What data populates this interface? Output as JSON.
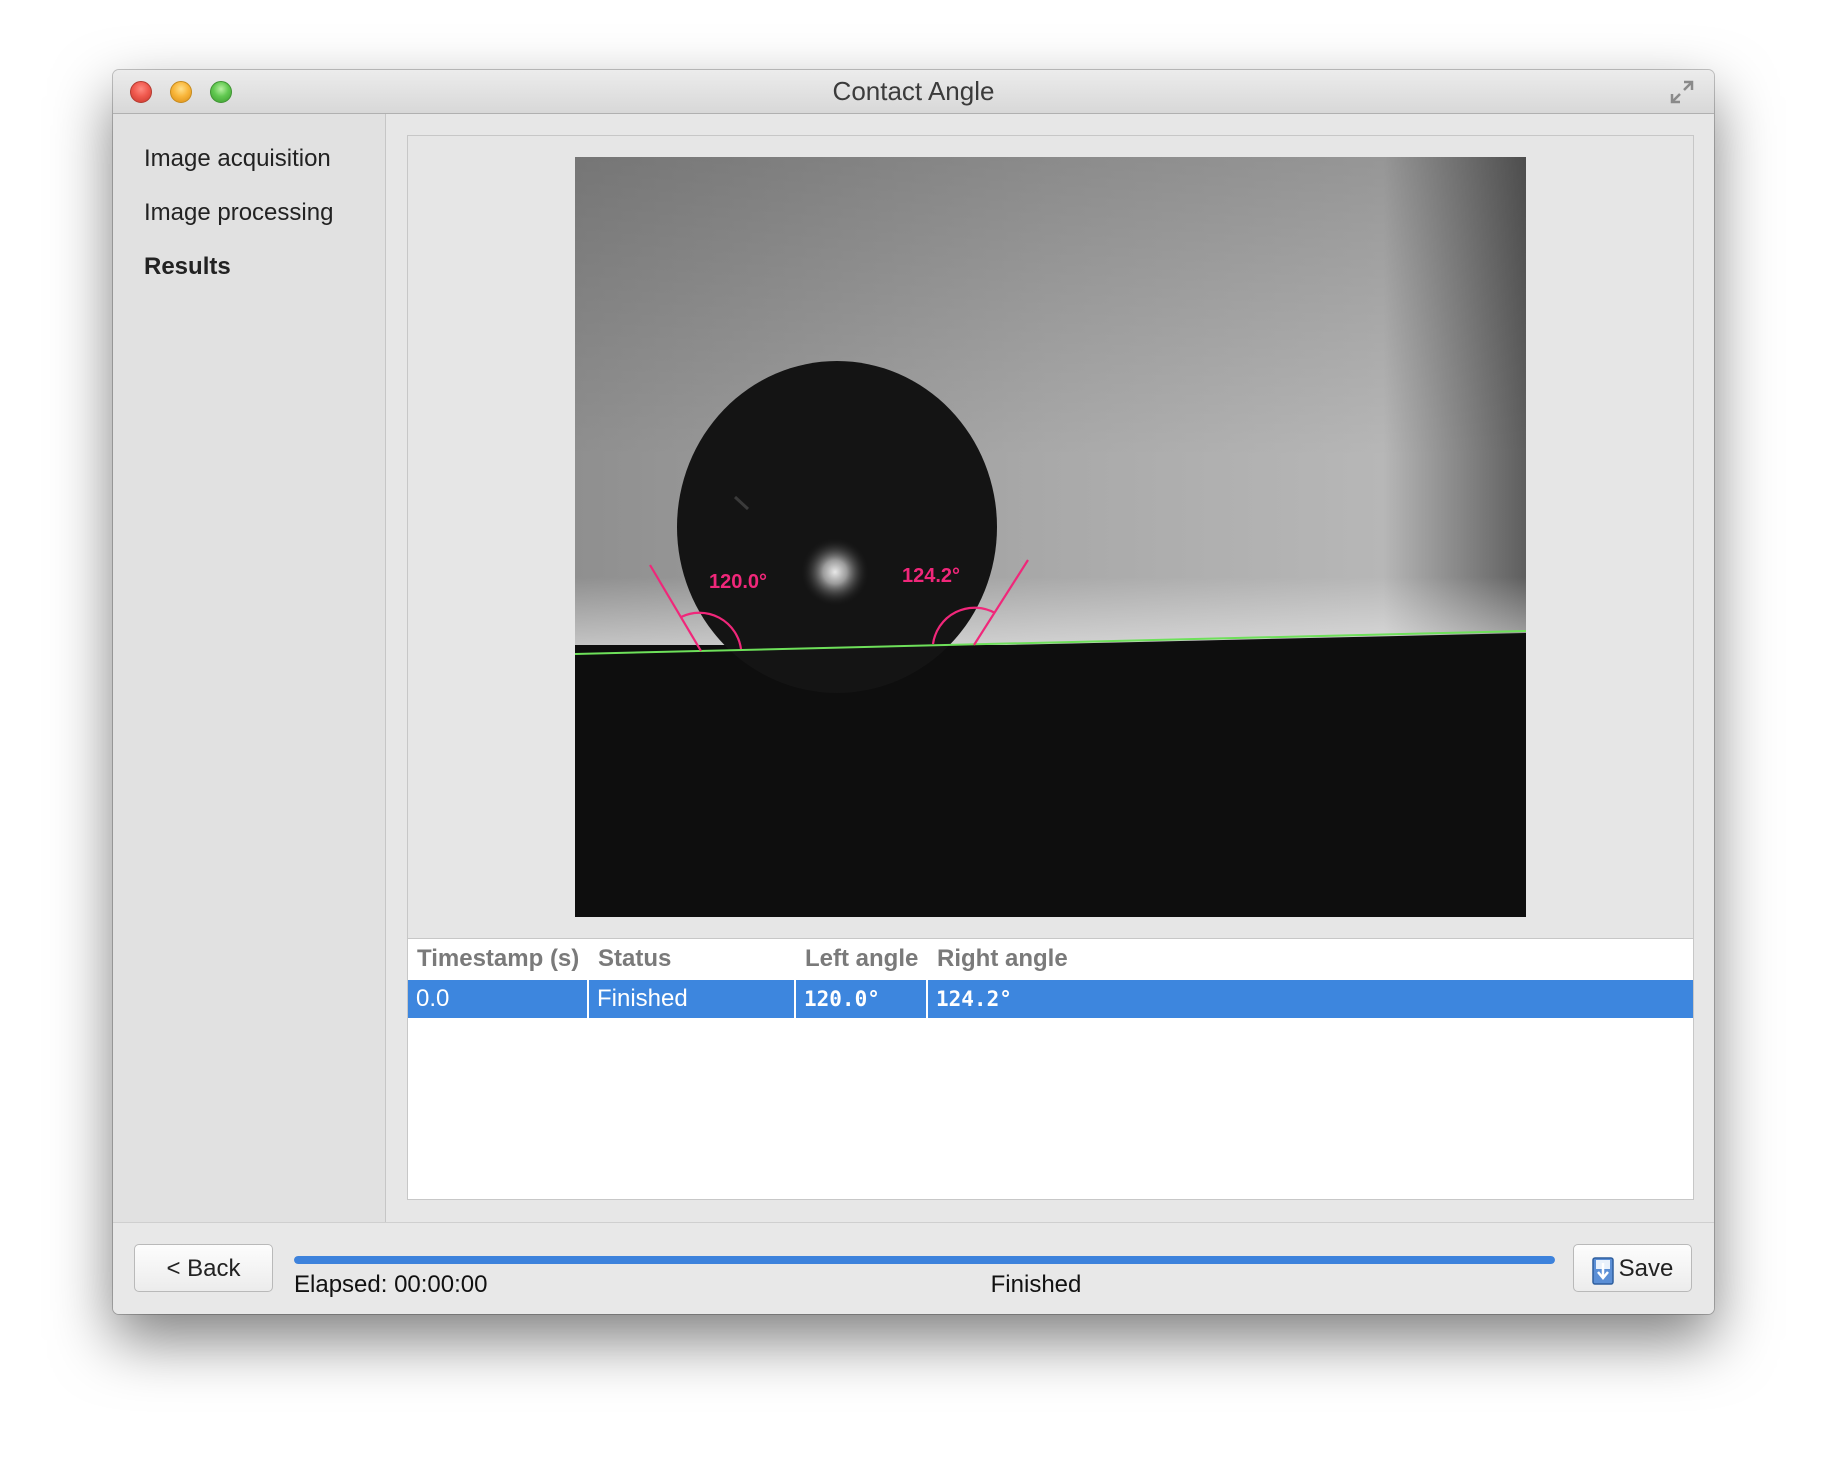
{
  "window": {
    "title": "Contact Angle"
  },
  "sidebar": {
    "items": [
      {
        "label": "Image acquisition",
        "active": false
      },
      {
        "label": "Image processing",
        "active": false
      },
      {
        "label": "Results",
        "active": true
      }
    ]
  },
  "image": {
    "angle_labels": {
      "left": "120.0°",
      "right": "124.2°"
    },
    "colors": {
      "angle_annotation": "#f0277a",
      "baseline": "#6ee05a"
    }
  },
  "table": {
    "columns": [
      "Timestamp (s)",
      "Status",
      "Left angle",
      "Right angle"
    ],
    "rows": [
      {
        "timestamp": "0.0",
        "status": "Finished",
        "left_angle": "120.0°",
        "right_angle": "124.2°",
        "selected": true
      }
    ]
  },
  "footer": {
    "back_label": "< Back",
    "save_label": "Save",
    "elapsed": "Elapsed: 00:00:00",
    "status": "Finished",
    "progress": 1.0
  },
  "icons": {
    "save": "save-download-icon",
    "fullscreen": "fullscreen-arrows-icon"
  }
}
